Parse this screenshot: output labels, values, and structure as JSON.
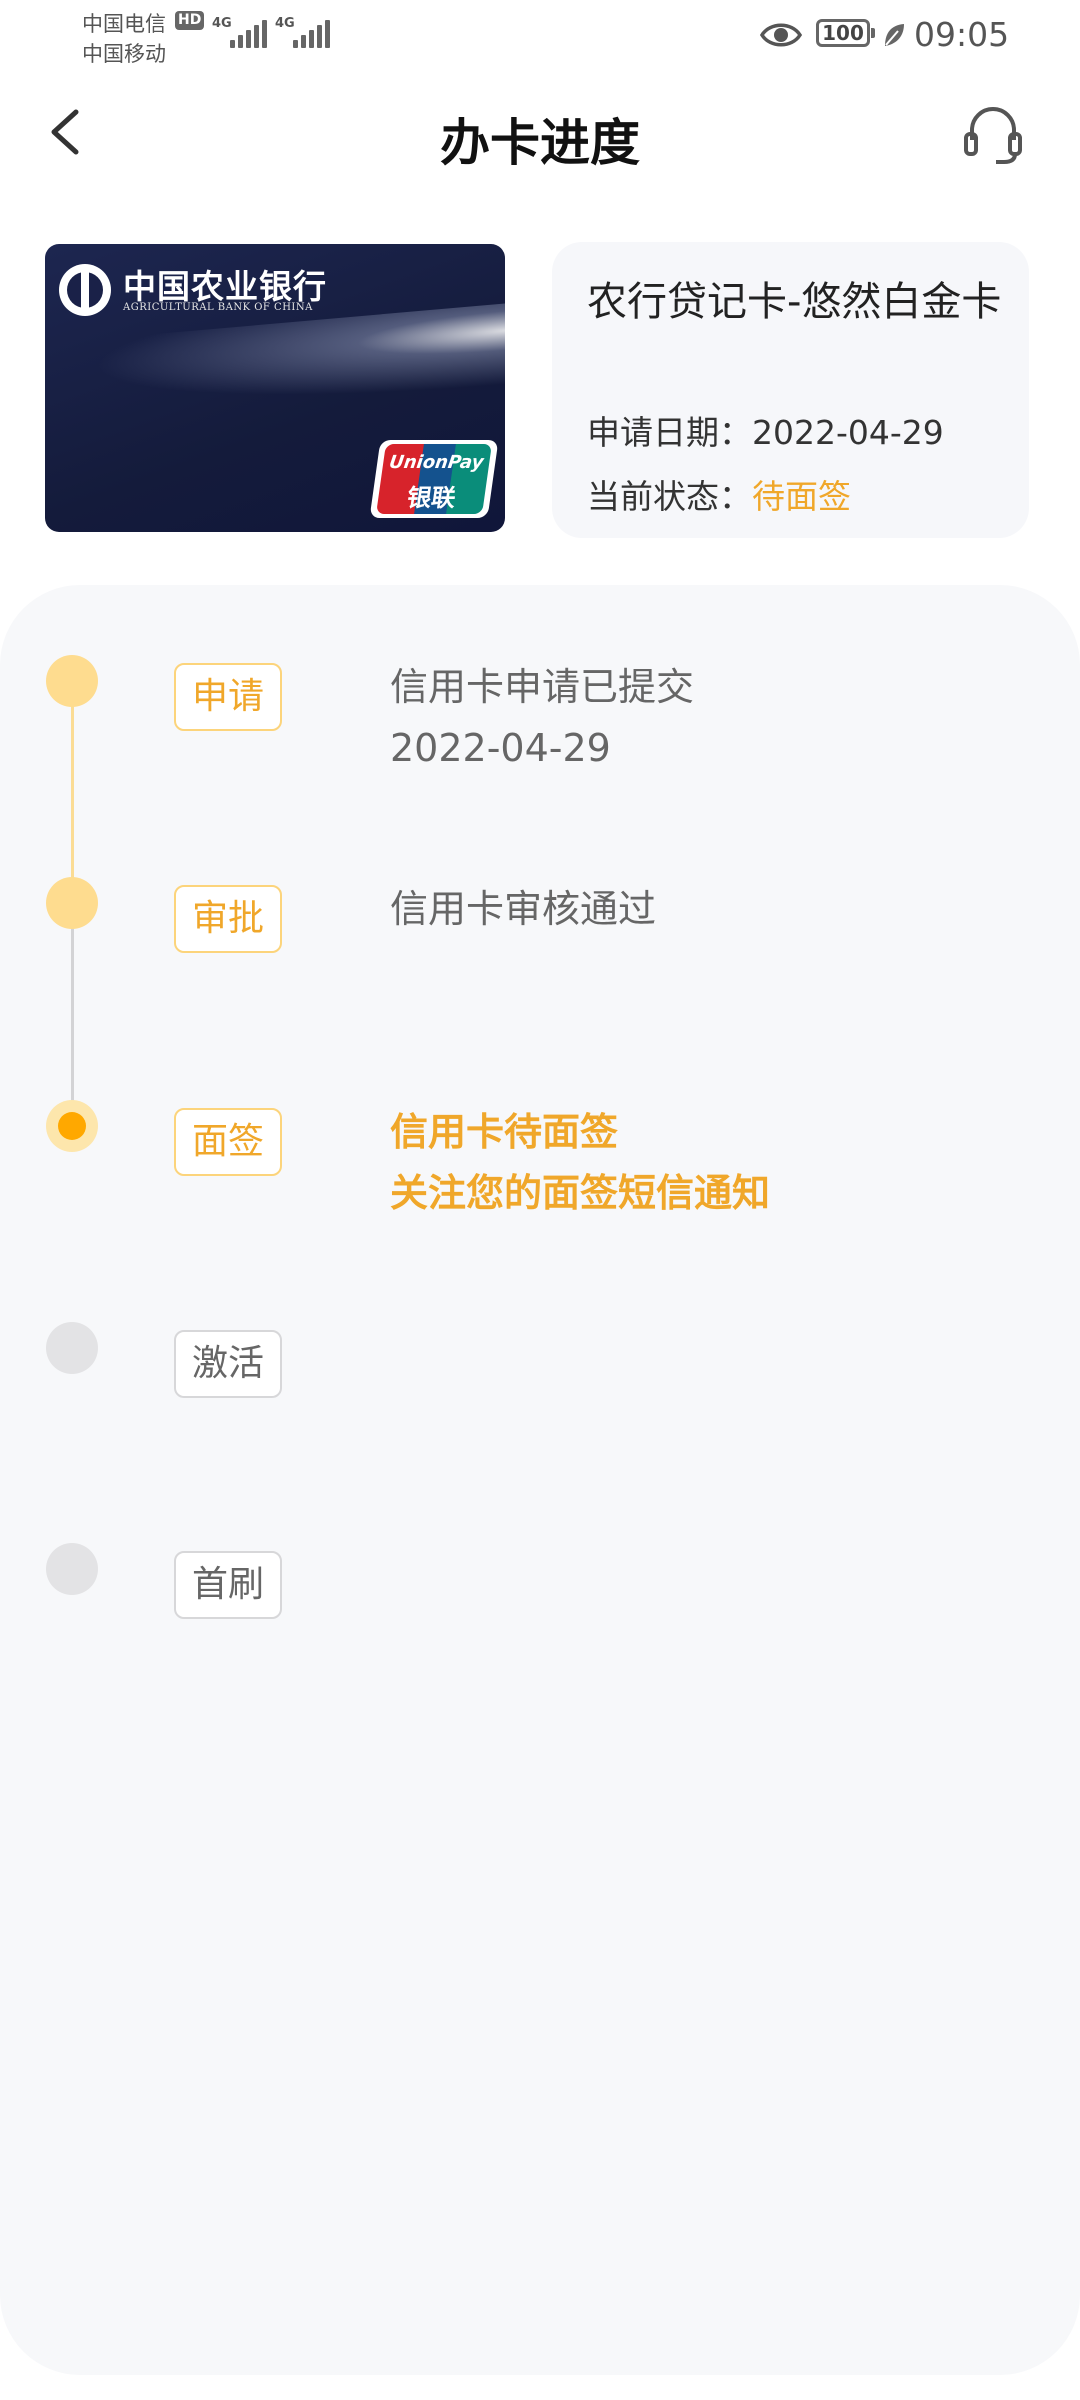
{
  "status_bar": {
    "carrier1": "中国电信",
    "carrier2": "中国移动",
    "hd": "HD",
    "signal_tag": "4G",
    "battery": "100",
    "time": "09:05"
  },
  "header": {
    "title": "办卡进度"
  },
  "card_face": {
    "bank_name_cn": "中国农业银行",
    "bank_name_en": "AGRICULTURAL BANK OF CHINA",
    "unionpay_en": "UnionPay",
    "unionpay_cn": "银联"
  },
  "card": {
    "name": "农行贷记卡-悠然白金卡",
    "date_label": "申请日期：",
    "date": "2022-04-29",
    "status_label": "当前状态：",
    "status": "待面签"
  },
  "steps": [
    {
      "label": "申请",
      "state": "done",
      "line1": "信用卡申请已提交",
      "line2": "2022-04-29"
    },
    {
      "label": "审批",
      "state": "done",
      "line1": "信用卡审核通过",
      "line2": ""
    },
    {
      "label": "面签",
      "state": "current",
      "line1": "信用卡待面签",
      "line2": "关注您的面签短信通知"
    },
    {
      "label": "激活",
      "state": "pending",
      "line1": "",
      "line2": ""
    },
    {
      "label": "首刷",
      "state": "pending",
      "line1": "",
      "line2": ""
    }
  ],
  "colors": {
    "accent": "#f0a72a",
    "dot_done": "#fedc8f",
    "dot_current": "#ffa800",
    "dot_pending": "#e3e3e5",
    "panel_bg": "#f7f8fa"
  }
}
